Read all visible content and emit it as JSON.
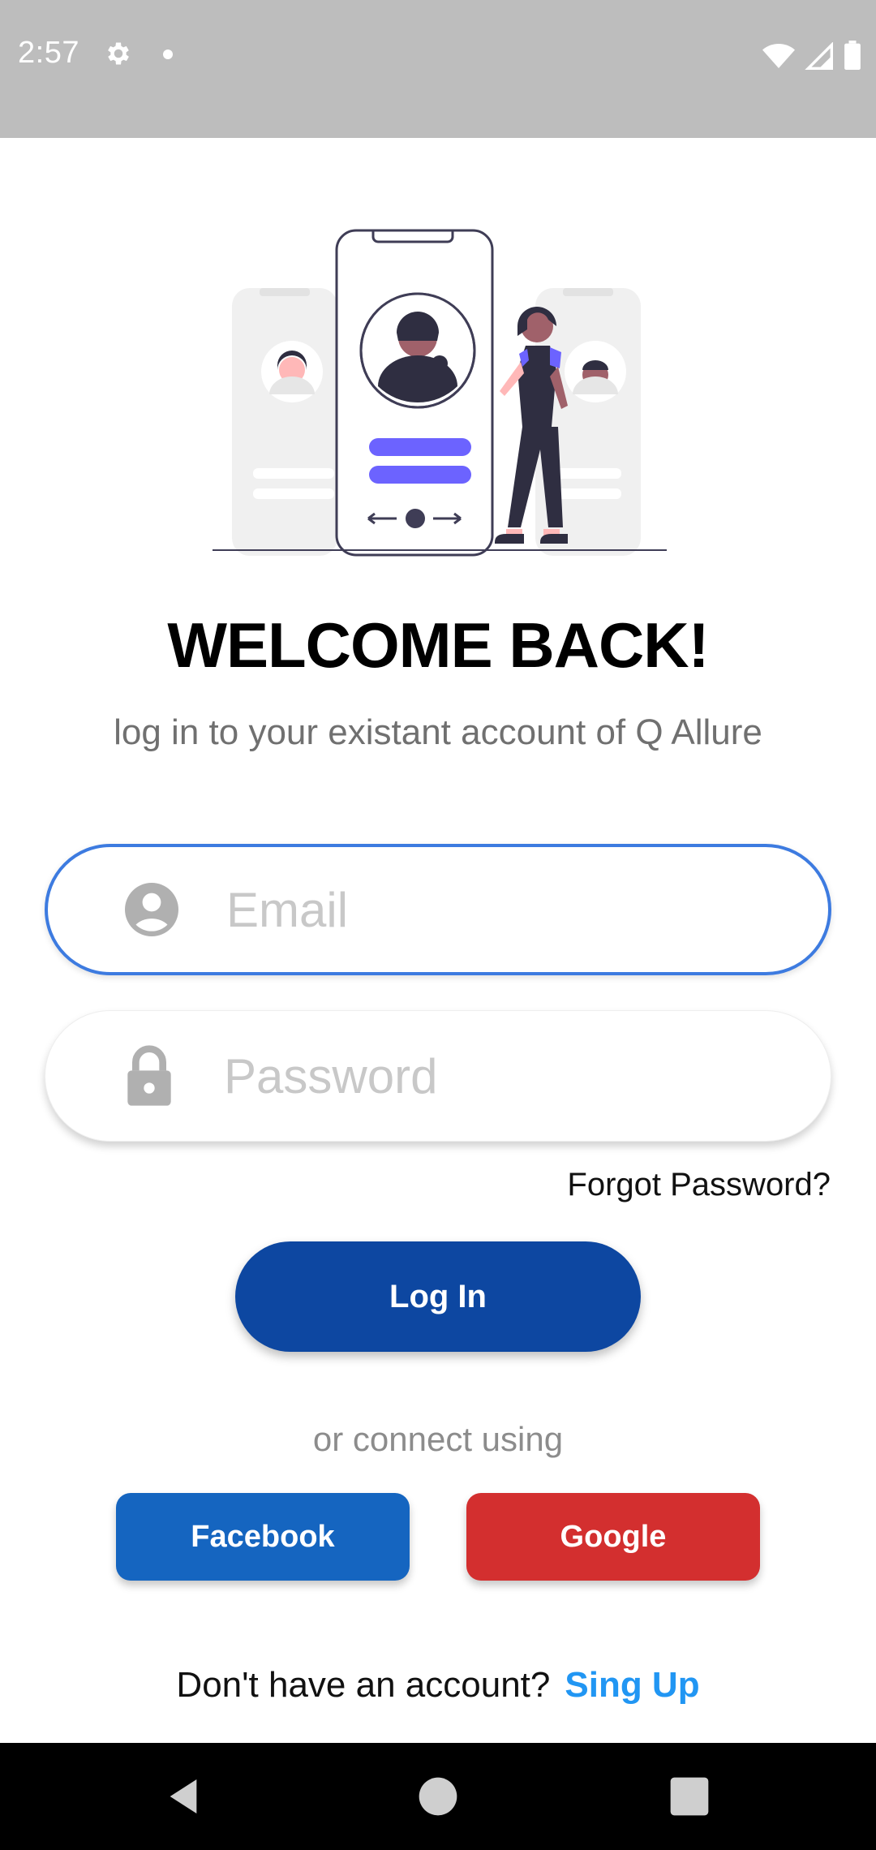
{
  "status_bar": {
    "time": "2:57",
    "icons": [
      "gear-icon",
      "notification-dot-icon",
      "wifi-icon",
      "cell-signal-icon",
      "battery-icon"
    ]
  },
  "hero": {
    "illustration": "login-illustration"
  },
  "header": {
    "title": "WELCOME BACK!",
    "subtitle": "log in to your existant account of Q Allure"
  },
  "form": {
    "email": {
      "placeholder": "Email",
      "value": "",
      "icon": "person-icon"
    },
    "password": {
      "placeholder": "Password",
      "value": "",
      "icon": "lock-icon"
    },
    "forgot_label": "Forgot Password?",
    "login_label": "Log In"
  },
  "social": {
    "prompt": "or connect using",
    "facebook_label": "Facebook",
    "google_label": "Google"
  },
  "footer": {
    "prompt": "Don't have an account?",
    "signup_label": "Sing Up"
  },
  "colors": {
    "primary": "#0d47a1",
    "facebook": "#1565c0",
    "google": "#d32f2f",
    "link": "#2196f3",
    "focus_border": "#3d7be0",
    "illustration_accent": "#6c63ff"
  }
}
